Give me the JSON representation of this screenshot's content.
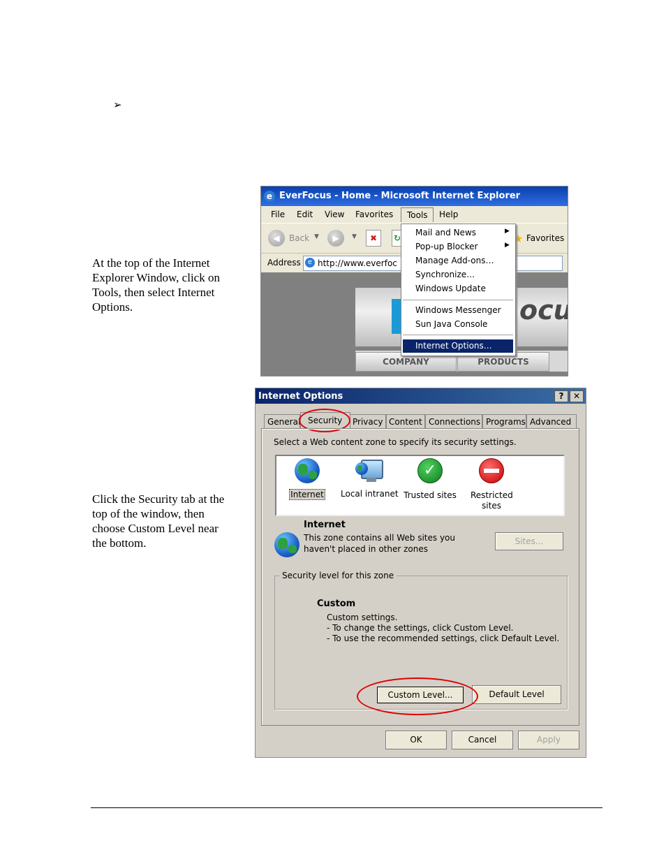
{
  "bullet_glyph": "➢",
  "instructions": {
    "step1": "At the top of the Internet Explorer Window, click on Tools, then select Internet Options.",
    "step2": "Click the Security tab at the top of the window, then choose Custom Level near the bottom."
  },
  "ie": {
    "title": "EverFocus - Home - Microsoft Internet Explorer",
    "menu": [
      "File",
      "Edit",
      "View",
      "Favorites",
      "Tools",
      "Help"
    ],
    "back_label": "Back",
    "favorites_label": "Favorites",
    "address_label": "Address",
    "address_value": "http://www.everfoc",
    "tools_menu": [
      "Mail and News",
      "Pop-up Blocker",
      "Manage Add-ons…",
      "Synchronize…",
      "Windows Update",
      "Windows Messenger",
      "Sun Java Console",
      "Internet Options…"
    ],
    "page_logo_text": "ocus",
    "page_nav": [
      "COMPANY",
      "PRODUCTS"
    ]
  },
  "dialog": {
    "title": "Internet Options",
    "tabs": [
      "General",
      "Security",
      "Privacy",
      "Content",
      "Connections",
      "Programs",
      "Advanced"
    ],
    "prompt": "Select a Web content zone to specify its security settings.",
    "zones": [
      {
        "label": "Internet",
        "icon": "globe-icon"
      },
      {
        "label": "Local intranet",
        "icon": "monitor-globe-icon"
      },
      {
        "label": "Trusted sites",
        "icon": "checkmark-icon"
      },
      {
        "label": "Restricted sites",
        "icon": "restricted-icon"
      }
    ],
    "zone_heading": "Internet",
    "zone_desc1": "This zone contains all Web sites you",
    "zone_desc2": "haven't placed in other zones",
    "sites_button": "Sites...",
    "group_label": "Security level for this zone",
    "level_title": "Custom",
    "level_desc": [
      "Custom settings.",
      "- To change the settings, click Custom Level.",
      "- To use the recommended settings, click Default Level."
    ],
    "custom_level_button": "Custom Level...",
    "default_level_button": "Default Level",
    "ok_button": "OK",
    "cancel_button": "Cancel",
    "apply_button": "Apply"
  },
  "colors": {
    "highlight": "#0a246a",
    "annotation": "#e00000",
    "titlebar": "#0a3fae"
  }
}
